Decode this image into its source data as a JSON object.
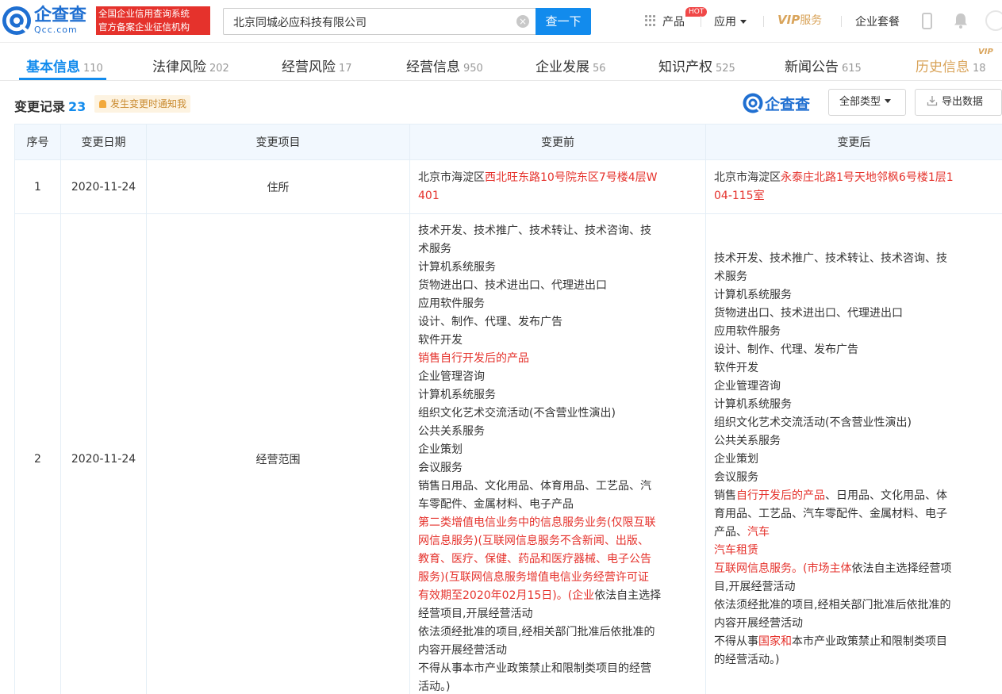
{
  "header": {
    "logo_cn": "企查查",
    "logo_en": "Qcc.com",
    "slogan_line1": "全国企业信用查询系统",
    "slogan_line2": "官方备案企业征信机构",
    "search_value": "北京同城必应科技有限公司",
    "search_button": "查一下",
    "nav": {
      "products": "产品",
      "products_badge": "HOT",
      "apps": "应用",
      "vip_service_strong": "VIP",
      "vip_service_text": "服务",
      "enterprise_package": "企业套餐"
    }
  },
  "tabs": [
    {
      "label": "基本信息",
      "count": "110",
      "active": true
    },
    {
      "label": "法律风险",
      "count": "202"
    },
    {
      "label": "经营风险",
      "count": "17"
    },
    {
      "label": "经营信息",
      "count": "950"
    },
    {
      "label": "企业发展",
      "count": "56"
    },
    {
      "label": "知识产权",
      "count": "525"
    },
    {
      "label": "新闻公告",
      "count": "615"
    },
    {
      "label": "历史信息",
      "count": "18",
      "badge": "VIP"
    }
  ],
  "section": {
    "title": "变更记录",
    "count": "23",
    "notify_label": "发生变更时通知我",
    "watermark": "企查查",
    "filter_label": "全部类型",
    "export_label": "导出数据"
  },
  "table": {
    "headers": [
      "序号",
      "变更日期",
      "变更项目",
      "变更前",
      "变更后"
    ],
    "rows": [
      {
        "index": "1",
        "date": "2020-11-24",
        "item": "住所",
        "before": [
          [
            {
              "t": "北京市海淀区"
            },
            {
              "t": "西北旺东路10号院东区7号楼4层W",
              "red": true
            }
          ],
          [
            {
              "t": "401",
              "red": true
            }
          ]
        ],
        "after": [
          [
            {
              "t": "北京市海淀区"
            },
            {
              "t": "永泰庄北路1号天地邻枫6号楼1层1",
              "red": true
            }
          ],
          [
            {
              "t": "04-115室",
              "red": true
            }
          ]
        ]
      },
      {
        "index": "2",
        "date": "2020-11-24",
        "item": "经营范围",
        "before": [
          [
            {
              "t": "技术开发、技术推广、技术转让、技术咨询、技"
            }
          ],
          [
            {
              "t": "术服务"
            }
          ],
          [
            {
              "t": "计算机系统服务"
            }
          ],
          [
            {
              "t": "货物进出口、技术进出口、代理进出口"
            }
          ],
          [
            {
              "t": "应用软件服务"
            }
          ],
          [
            {
              "t": "设计、制作、代理、发布广告"
            }
          ],
          [
            {
              "t": "软件开发"
            }
          ],
          [
            {
              "t": "销售自行开发后的产品",
              "red": true
            }
          ],
          [
            {
              "t": "企业管理咨询"
            }
          ],
          [
            {
              "t": "计算机系统服务"
            }
          ],
          [
            {
              "t": "组织文化艺术交流活动(不含营业性演出)"
            }
          ],
          [
            {
              "t": "公共关系服务"
            }
          ],
          [
            {
              "t": "企业策划"
            }
          ],
          [
            {
              "t": "会议服务"
            }
          ],
          [
            {
              "t": "销售日用品、文化用品、体育用品、工艺品、汽"
            }
          ],
          [
            {
              "t": "车零配件、金属材料、电子产品"
            }
          ],
          [
            {
              "t": "第二类增值电信业务中的信息服务业务(仅限互联",
              "red": true
            }
          ],
          [
            {
              "t": "网信息服务)(互联网信息服务不含新闻、出版、",
              "red": true
            }
          ],
          [
            {
              "t": "教育、医疗、保健、药品和医疗器械、电子公告",
              "red": true
            }
          ],
          [
            {
              "t": "服务)(互联网信息服务增值电信业务经营许可证",
              "red": true
            }
          ],
          [
            {
              "t": "有效期至2020年02月15日)。(企业",
              "red": true
            },
            {
              "t": "依法自主选择"
            }
          ],
          [
            {
              "t": "经营项目,开展经营活动"
            }
          ],
          [
            {
              "t": "依法须经批准的项目,经相关部门批准后依批准的"
            }
          ],
          [
            {
              "t": "内容开展经营活动"
            }
          ],
          [
            {
              "t": "不得从事本市产业政策禁止和限制类项目的经营"
            }
          ],
          [
            {
              "t": "活动。)"
            }
          ]
        ],
        "after": [
          [
            {
              "t": "技术开发、技术推广、技术转让、技术咨询、技"
            }
          ],
          [
            {
              "t": "术服务"
            }
          ],
          [
            {
              "t": "计算机系统服务"
            }
          ],
          [
            {
              "t": "货物进出口、技术进出口、代理进出口"
            }
          ],
          [
            {
              "t": "应用软件服务"
            }
          ],
          [
            {
              "t": "设计、制作、代理、发布广告"
            }
          ],
          [
            {
              "t": "软件开发"
            }
          ],
          [
            {
              "t": "企业管理咨询"
            }
          ],
          [
            {
              "t": "计算机系统服务"
            }
          ],
          [
            {
              "t": "组织文化艺术交流活动(不含营业性演出)"
            }
          ],
          [
            {
              "t": "公共关系服务"
            }
          ],
          [
            {
              "t": "企业策划"
            }
          ],
          [
            {
              "t": "会议服务"
            }
          ],
          [
            {
              "t": "销售"
            },
            {
              "t": "自行开发后的产品",
              "red": true
            },
            {
              "t": "、日用品、文化用品、体"
            }
          ],
          [
            {
              "t": "育用品、工艺品、汽车零配件、金属材料、电子"
            }
          ],
          [
            {
              "t": "产品、"
            },
            {
              "t": "汽车",
              "red": true
            }
          ],
          [
            {
              "t": "汽车租赁",
              "red": true
            }
          ],
          [
            {
              "t": "互联网信息服务。(市场主体",
              "red": true
            },
            {
              "t": "依法自主选择经营项"
            }
          ],
          [
            {
              "t": "目,开展经营活动"
            }
          ],
          [
            {
              "t": "依法须经批准的项目,经相关部门批准后依批准的"
            }
          ],
          [
            {
              "t": "内容开展经营活动"
            }
          ],
          [
            {
              "t": "不得从事"
            },
            {
              "t": "国家和",
              "red": true
            },
            {
              "t": "本市产业政策禁止和限制类项目"
            }
          ],
          [
            {
              "t": "的经营活动。)"
            }
          ]
        ]
      }
    ]
  },
  "colors": {
    "accent": "#128bed",
    "highlight_red": "#e5322c",
    "vip_gold": "#d9a45b",
    "table_header_bg": "#f2f8fe"
  }
}
